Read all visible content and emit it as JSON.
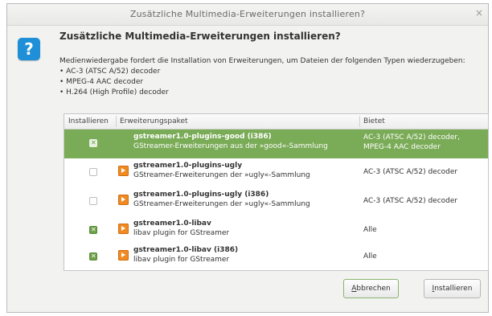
{
  "window": {
    "title": "Zusätzliche Multimedia-Erweiterungen installieren?",
    "close_glyph": "×"
  },
  "dialog": {
    "icon": "question-icon",
    "icon_glyph": "?",
    "heading": "Zusätzliche Multimedia-Erweiterungen installieren?",
    "description": "Medienwiedergabe fordert die Installation von Erweiterungen, um Dateien der folgenden Typen wiederzugeben:",
    "types": [
      "AC-3 (ATSC A/52) decoder",
      "MPEG-4 AAC decoder",
      "H.264 (High Profile) decoder"
    ]
  },
  "table": {
    "columns": [
      "Installieren",
      "Erweiterungspaket",
      "Bietet"
    ],
    "rows": [
      {
        "checked": true,
        "selected": true,
        "name": "gstreamer1.0-plugins-good (i386)",
        "description": "GStreamer-Erweiterungen aus der »good«-Sammlung",
        "offers": "AC-3 (ATSC A/52) decoder, MPEG-4 AAC decoder"
      },
      {
        "checked": false,
        "selected": false,
        "name": "gstreamer1.0-plugins-ugly",
        "description": "GStreamer-Erweiterungen der »ugly«-Sammlung",
        "offers": "AC-3 (ATSC A/52) decoder"
      },
      {
        "checked": false,
        "selected": false,
        "name": "gstreamer1.0-plugins-ugly (i386)",
        "description": "GStreamer-Erweiterungen der »ugly«-Sammlung",
        "offers": "AC-3 (ATSC A/52) decoder"
      },
      {
        "checked": true,
        "selected": false,
        "name": "gstreamer1.0-libav",
        "description": "libav plugin for GStreamer",
        "offers": "Alle"
      },
      {
        "checked": true,
        "selected": false,
        "name": "gstreamer1.0-libav (i386)",
        "description": "libav plugin for GStreamer",
        "offers": "Alle"
      }
    ]
  },
  "buttons": {
    "cancel": {
      "mnemonic": "A",
      "rest": "bbrechen"
    },
    "install": {
      "mnemonic": "I",
      "rest": "nstallieren"
    }
  },
  "colors": {
    "selection": "#7aab57",
    "accent_icon": "#1f8fd7",
    "package_icon": "#f08a23"
  }
}
